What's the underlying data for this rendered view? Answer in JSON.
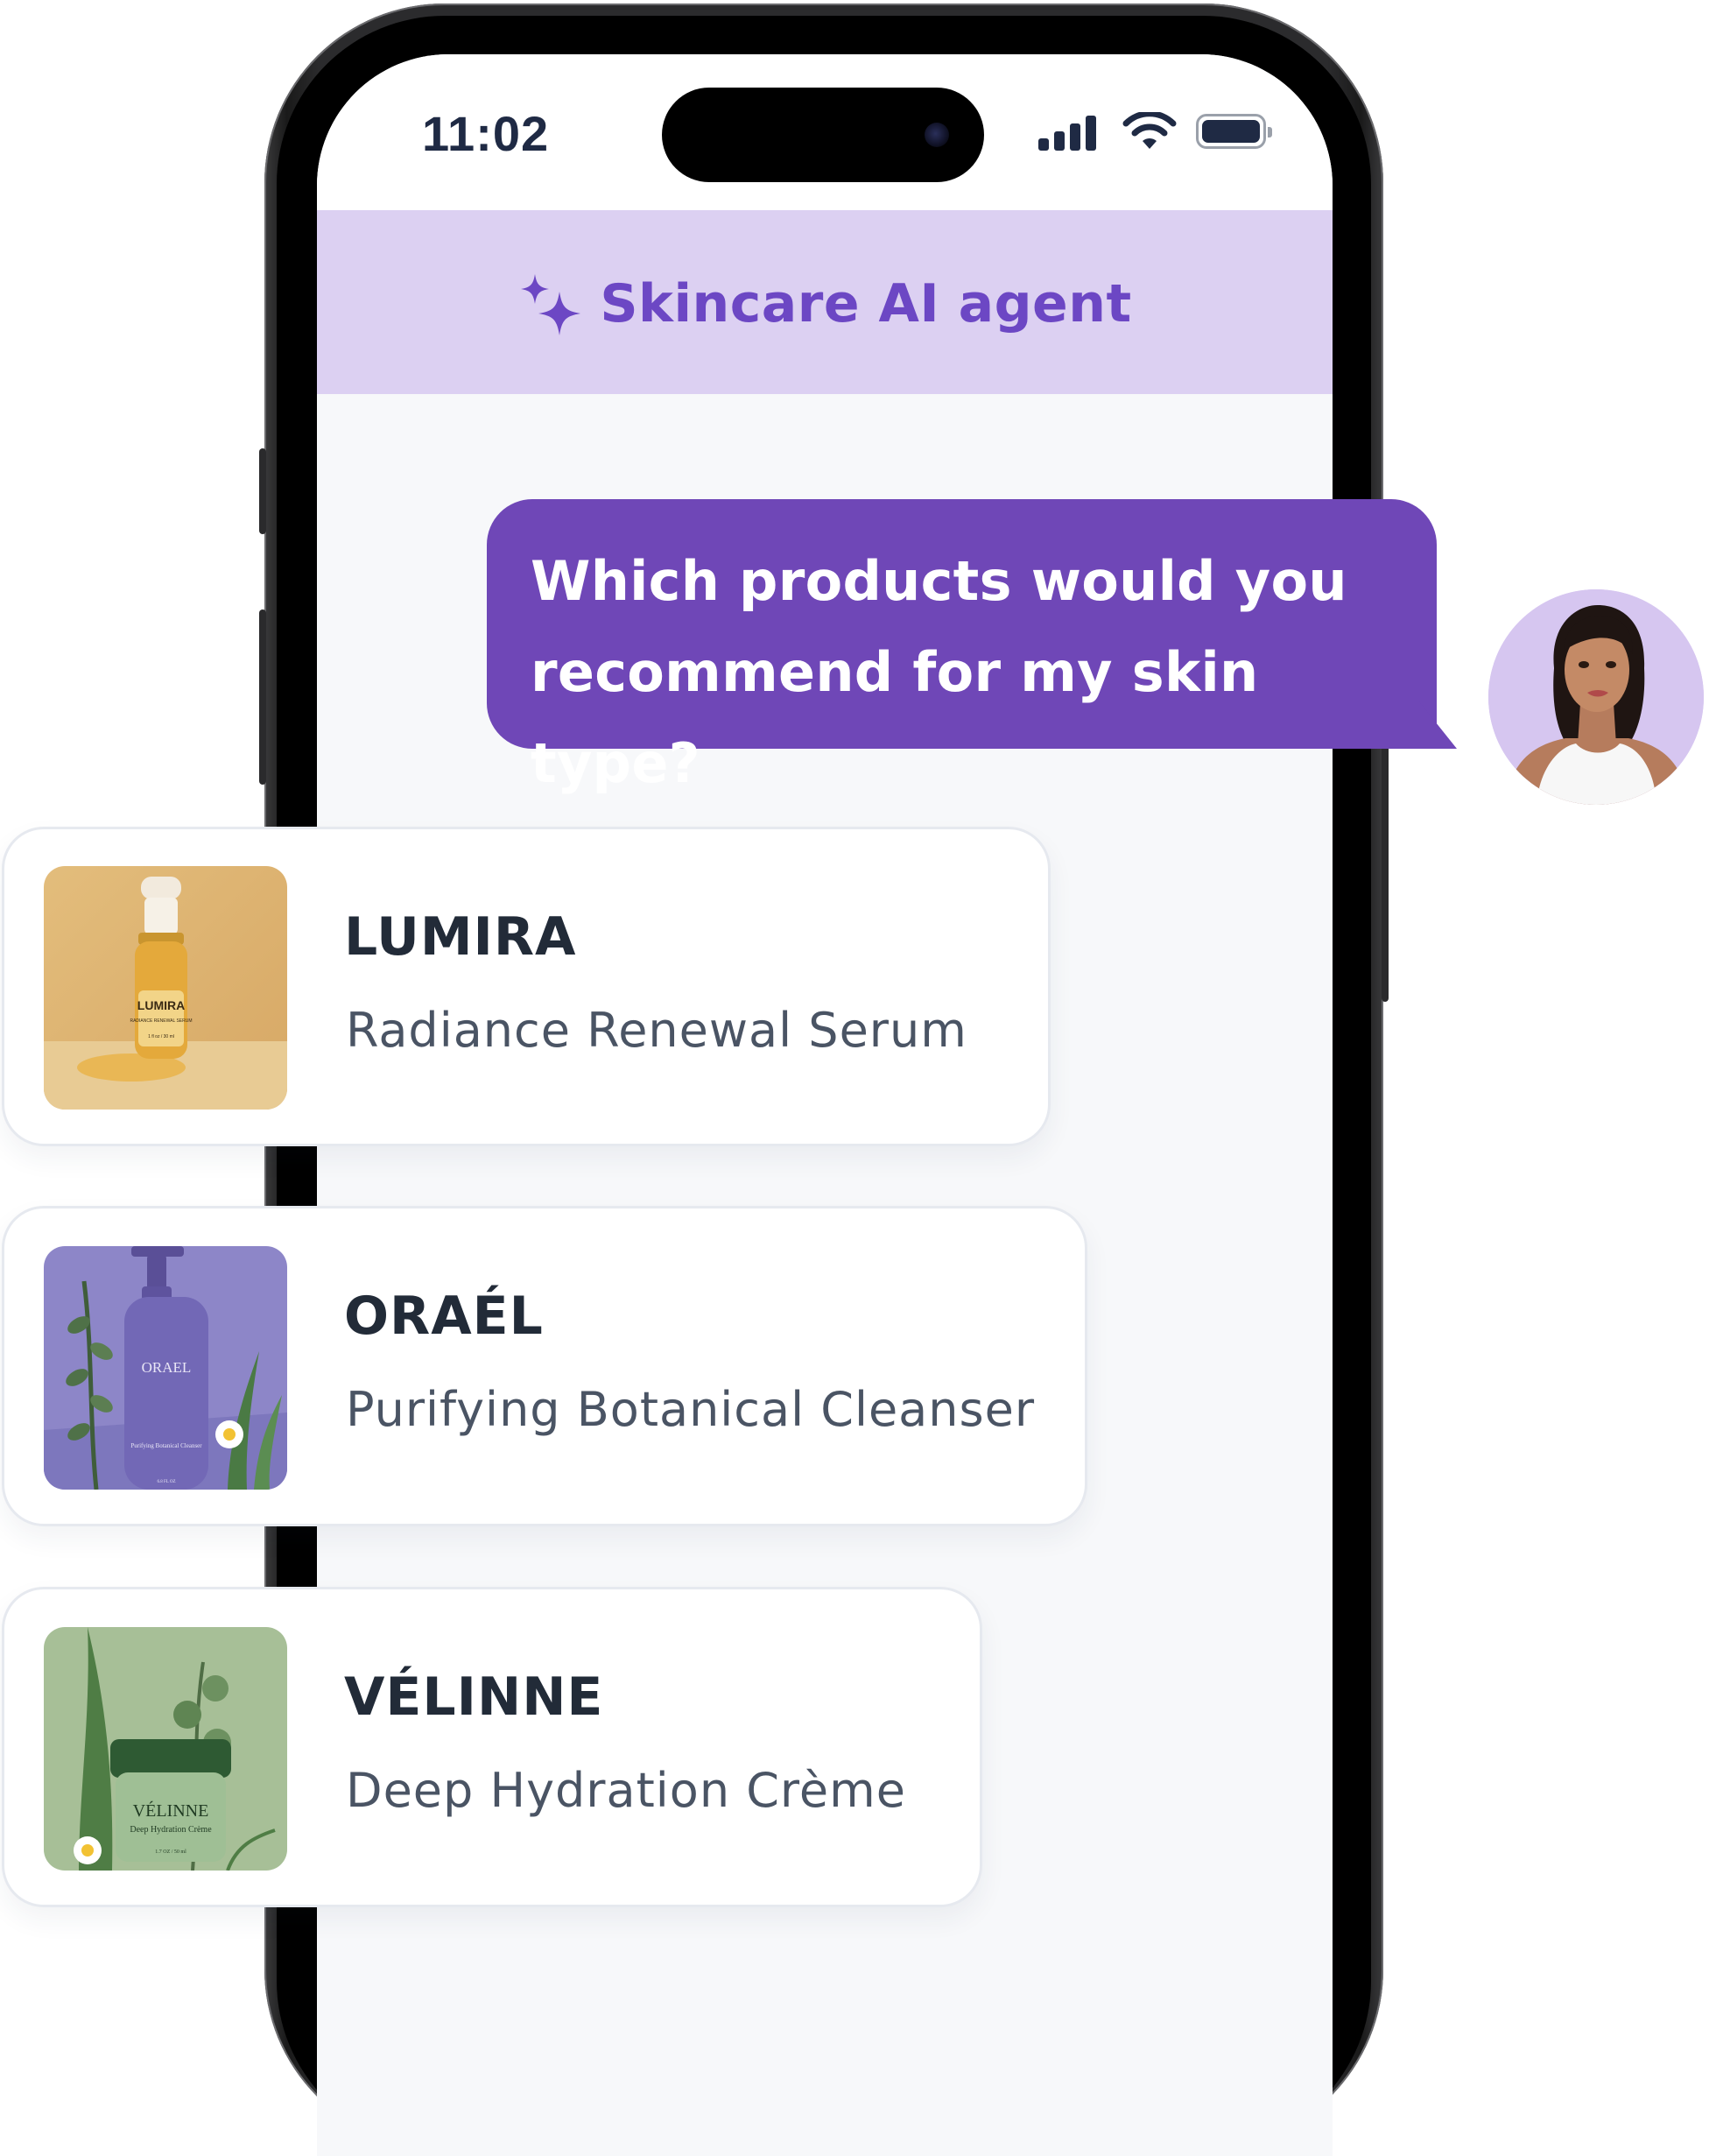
{
  "status_bar": {
    "time": "11:02"
  },
  "header": {
    "title": "Skincare AI agent",
    "icon": "sparkle-icon"
  },
  "chat": {
    "user_message_line1": "Which products would you",
    "user_message_line2": "recommend for my skin type?"
  },
  "products": [
    {
      "brand": "LUMIRA",
      "name": "Radiance Renewal Serum",
      "bottle_label": "LUMIRA",
      "bottle_sub": "RADIANCE RENEWAL SERUM",
      "bottle_size": "1 fl oz / 30 ml"
    },
    {
      "brand": "ORAÉL",
      "name": "Purifying Botanical Cleanser",
      "bottle_label": "ORAEL",
      "bottle_sub": "Purifying Botanical Cleanser",
      "bottle_size": "6.8 FL OZ"
    },
    {
      "brand": "VÉLINNE",
      "name": "Deep Hydration Crème",
      "bottle_label": "VÉLINNE",
      "bottle_sub": "Deep Hydration Crème",
      "bottle_size": "1.7 OZ / 50 ml"
    }
  ],
  "colors": {
    "accent_purple": "#6f47b7",
    "header_bg": "#dcd0f2",
    "title_purple": "#6c47c4",
    "avatar_bg": "#d6c6f0",
    "text_dark": "#222b38",
    "text_gray": "#4a5464"
  }
}
